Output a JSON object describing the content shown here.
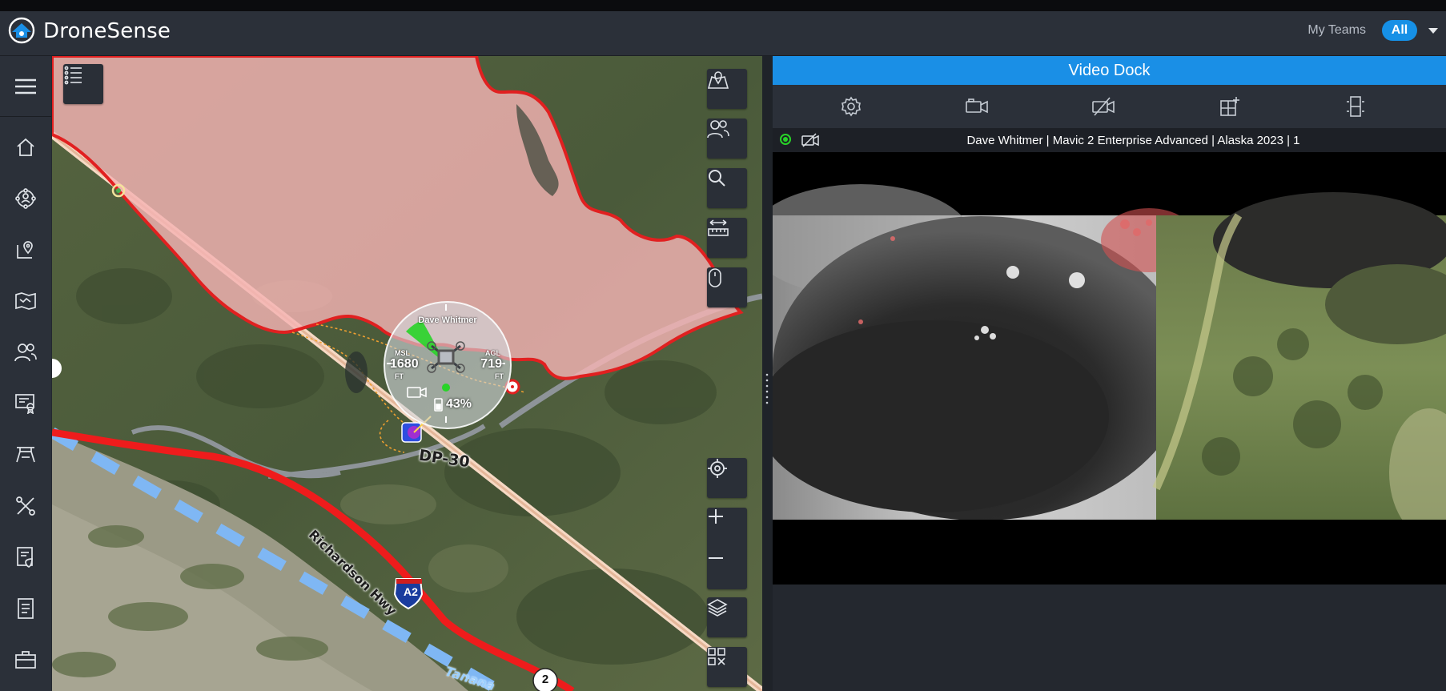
{
  "app": {
    "brand": "DroneSense"
  },
  "header": {
    "teams_label": "My Teams",
    "teams_filter": "All"
  },
  "sidebar": {
    "items": [
      {
        "icon": "menu-icon"
      },
      {
        "icon": "home-icon"
      },
      {
        "icon": "operations-icon"
      },
      {
        "icon": "map-pin-icon"
      },
      {
        "icon": "maps-icon"
      },
      {
        "icon": "people-icon"
      },
      {
        "icon": "certificate-icon"
      },
      {
        "icon": "drone-frame-icon"
      },
      {
        "icon": "tools-icon"
      },
      {
        "icon": "checklist-icon"
      },
      {
        "icon": "document-icon"
      },
      {
        "icon": "briefcase-icon"
      }
    ]
  },
  "map": {
    "drone_pilot": "Dave Whitmer",
    "msl_label": "MSL",
    "msl_value": "1680",
    "msl_unit": "FT",
    "agl_label": "AGL",
    "agl_value": "719",
    "agl_unit": "FT",
    "battery": "43%",
    "point_label": "DP-30",
    "road_label": "Richardson Hwy",
    "shield_a2": "A2",
    "shield_2": "2",
    "river_label_partial": "Tanana",
    "buttons": [
      "list-icon",
      "map-area-icon",
      "team-icon",
      "search-icon",
      "measure-icon",
      "mouse-icon",
      "locate-icon",
      "zoom-in-icon",
      "zoom-out-icon",
      "layers-icon",
      "grid-icon"
    ]
  },
  "dock": {
    "title": "Video Dock",
    "toolbar": [
      "settings-icon",
      "camera-icon",
      "camera-off-icon",
      "add-grid-icon",
      "layout-icon"
    ],
    "feed_title": "Dave Whitmer | Mavic 2 Enterprise Advanced | Alaska 2023 | 1"
  },
  "colors": {
    "accent": "#1a8fe6",
    "fire_perimeter": "#e12020",
    "fire_fill": "#f4b3b3",
    "road": "#ee1c1c",
    "live": "#28d428"
  }
}
